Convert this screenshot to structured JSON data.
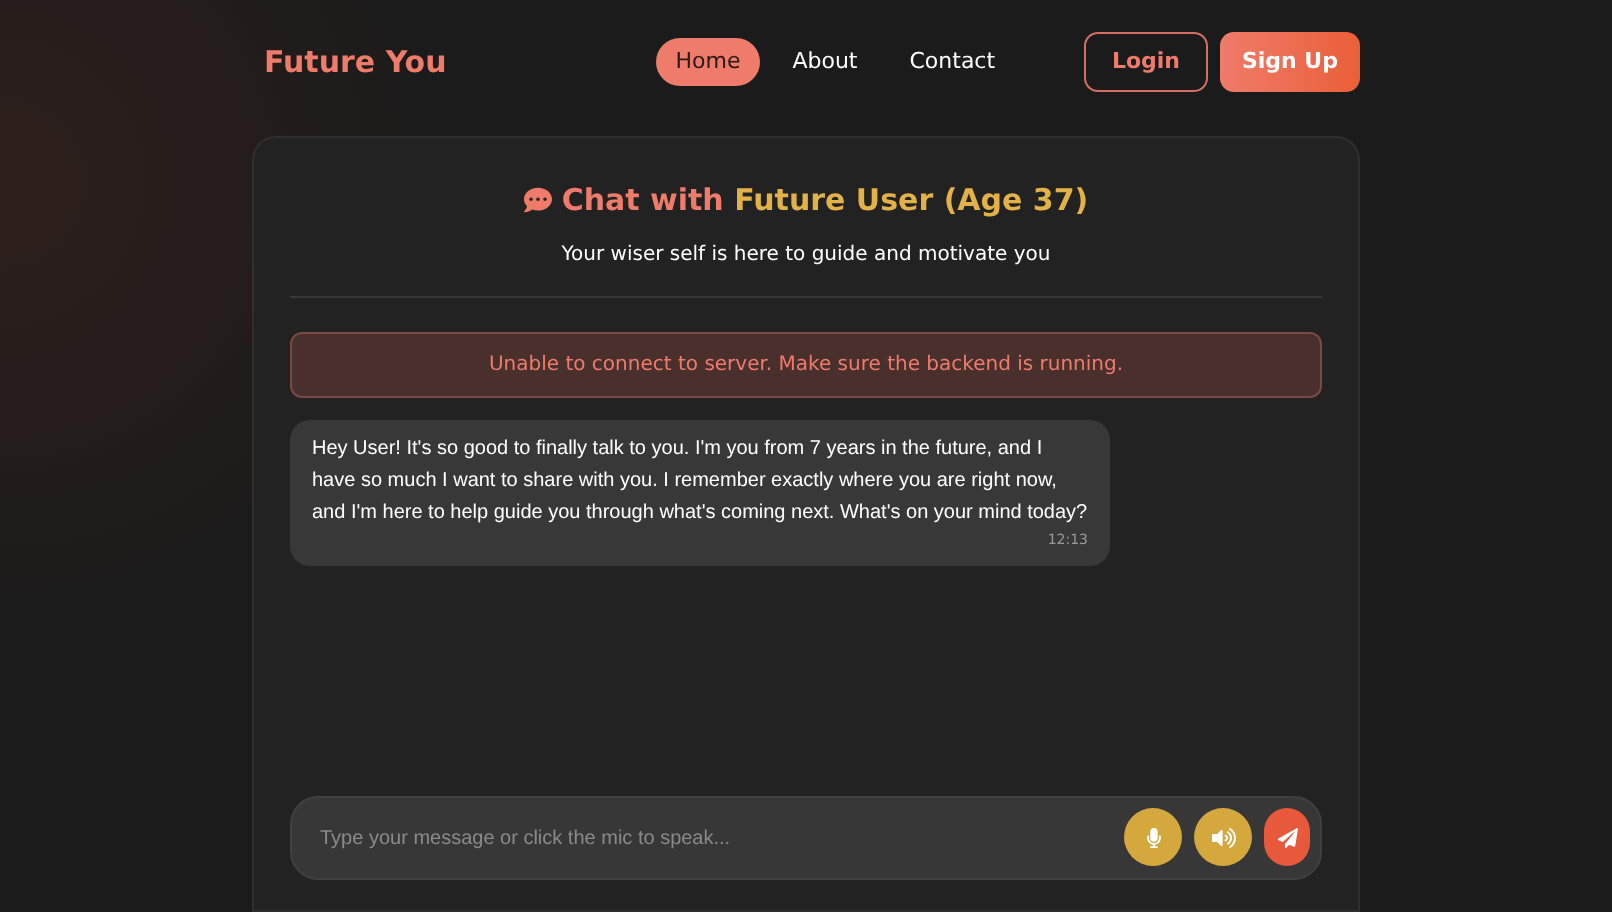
{
  "brand": "Future You",
  "nav": [
    {
      "label": "Home",
      "selected": true
    },
    {
      "label": "About",
      "selected": false
    },
    {
      "label": "Contact",
      "selected": false
    }
  ],
  "auth": [
    {
      "label": "Login",
      "kind": "outline"
    },
    {
      "label": "Sign Up",
      "kind": "filled"
    }
  ],
  "chat": {
    "title_prefix": "Chat with",
    "title_name": "Future User (Age 37)",
    "subtitle": "Your wiser self is here to guide and motivate you",
    "error": "Unable to connect to server. Make sure the backend is running.",
    "messages": [
      {
        "text": "Hey User! It's so good to finally talk to you. I'm you from 7 years in the future, and I have so much I want to share with you. I remember exactly where you are right now, and I'm here to help guide you through what's coming next. What's on your mind today?",
        "time": "12:13"
      }
    ],
    "input": {
      "placeholder": "Type your message or click the mic to speak..."
    }
  }
}
